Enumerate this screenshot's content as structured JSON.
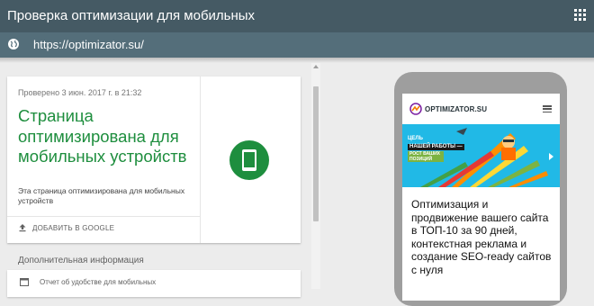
{
  "app": {
    "title": "Проверка оптимизации для мобильных"
  },
  "address": {
    "url": "https://optimizator.su/"
  },
  "result": {
    "checked_at": "Проверено 3 июн. 2017 г. в 21:32",
    "headline": "Страница оптимизирована для мобильных устройств",
    "description": "Эта страница оптимизирована для мобильных устройств",
    "add_button_label": "ДОБАВИТЬ В GOOGLE",
    "status_icon": "smartphone-icon",
    "status_color": "#1e8e3e"
  },
  "more_info": {
    "title": "Дополнительная информация",
    "report_label": "Отчет об удобстве для мобильных"
  },
  "preview": {
    "logo_text": "OPTIMIZATOR.SU",
    "banner_line1": "ЦЕЛЬ",
    "banner_line2": "НАШЕЙ РАБОТЫ —",
    "banner_line3": "РОСТ ВАШИХ ПОЗИЦИЙ",
    "site_text": "Оптимизация и продвижение вашего сайта в ТОП-10 за 90 дней, контекстная реклама и создание SEO-ready сайтов с нуля"
  },
  "colors": {
    "topbar": "#455a64",
    "urlbar": "#546e7a",
    "accent_green": "#1e8e3e",
    "banner_blue": "#21b9e6"
  }
}
